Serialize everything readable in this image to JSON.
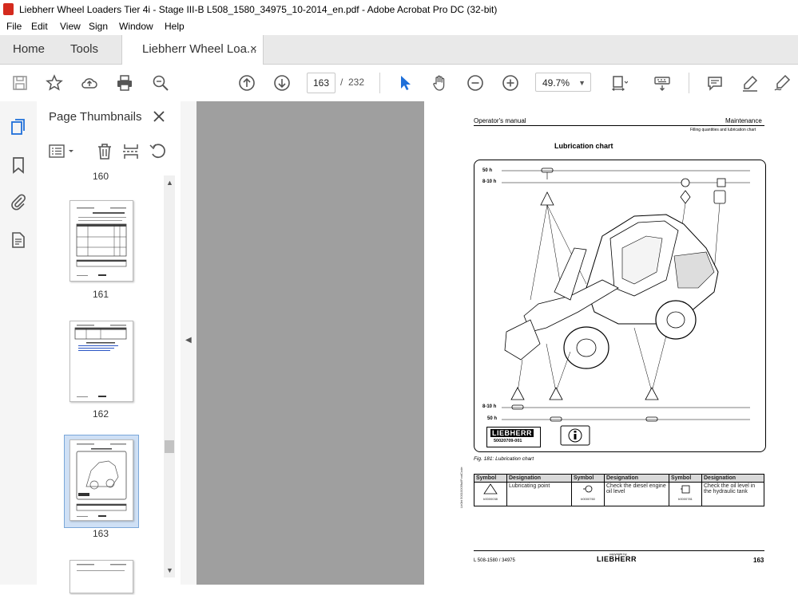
{
  "window": {
    "title": "Liebherr Wheel Loaders Tier 4i - Stage III-B L508_1580_34975_10-2014_en.pdf - Adobe Acrobat Pro DC (32-bit)"
  },
  "menu": [
    "File",
    "Edit",
    "View",
    "Sign",
    "Window",
    "Help"
  ],
  "tabs": {
    "home": "Home",
    "tools": "Tools",
    "document": "Liebherr Wheel Loa...",
    "close_glyph": "×"
  },
  "toolbar": {
    "page_current": "163",
    "page_separator": "/",
    "page_total": "232",
    "zoom": "49.7%"
  },
  "panel": {
    "title": "Page Thumbnails",
    "thumbnails": [
      {
        "label": "160"
      },
      {
        "label": "161"
      },
      {
        "label": "162"
      },
      {
        "label": "163",
        "selected": true
      }
    ]
  },
  "page": {
    "header_left": "Operator's manual",
    "header_right": "Maintenance",
    "subheader_right": "Filling quantities and lubrication chart",
    "heading": "Lubrication chart",
    "interval_50h": "50 h",
    "interval_8_10h": "8-10 h",
    "brand": "LIEBHERR",
    "doc_code": "50020709-001",
    "side_code": "Lb0bt 50010005fullFootCode",
    "fig_caption": "Fig. 181: Lubrication chart",
    "table": {
      "headers": [
        "Symbol",
        "Designation",
        "Symbol",
        "Designation",
        "Symbol",
        "Designation"
      ],
      "row": [
        {
          "code": "b0000038",
          "text": "Lubricating point"
        },
        {
          "code": "b0000760",
          "text": "Check the diesel engine oil level"
        },
        {
          "code": "b0000781",
          "text": "Check the oil level in the hydraulic tank"
        }
      ]
    },
    "footer_left": "L 508-1580 / 34975",
    "footer_copyright": "copyright by",
    "footer_brand": "LIEBHERR",
    "page_number": "163"
  }
}
